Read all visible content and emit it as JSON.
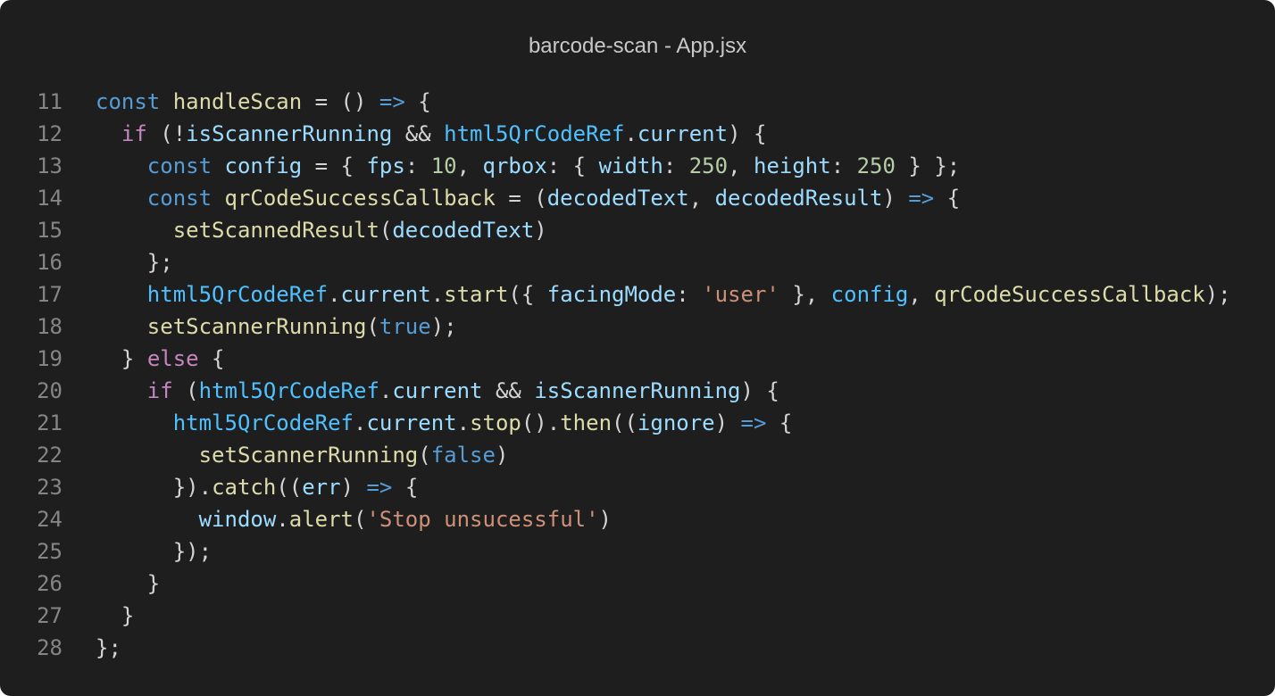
{
  "window": {
    "title": "barcode-scan - App.jsx"
  },
  "colors": {
    "background": "#1e1e1e",
    "line_number": "#858585",
    "keyword": "#569cd6",
    "control": "#c586c0",
    "function": "#dcdcaa",
    "variable": "#9cdcfe",
    "constant": "#4fc1ff",
    "number": "#b5cea8",
    "string": "#ce9178",
    "punctuation": "#d4d4d4"
  },
  "editor": {
    "lines": [
      {
        "number": "11",
        "indent": "",
        "tokens": [
          {
            "t": "const",
            "k": "kw"
          },
          {
            "t": " ",
            "k": "punc"
          },
          {
            "t": "handleScan",
            "k": "fn"
          },
          {
            "t": " = () ",
            "k": "punc"
          },
          {
            "t": "=>",
            "k": "kw"
          },
          {
            "t": " {",
            "k": "punc"
          }
        ]
      },
      {
        "number": "12",
        "indent": "  ",
        "tokens": [
          {
            "t": "if",
            "k": "ctl"
          },
          {
            "t": " (!",
            "k": "punc"
          },
          {
            "t": "isScannerRunning",
            "k": "var"
          },
          {
            "t": " && ",
            "k": "punc"
          },
          {
            "t": "html5QrCodeRef",
            "k": "const"
          },
          {
            "t": ".",
            "k": "punc"
          },
          {
            "t": "current",
            "k": "var"
          },
          {
            "t": ") {",
            "k": "punc"
          }
        ]
      },
      {
        "number": "13",
        "indent": "    ",
        "tokens": [
          {
            "t": "const",
            "k": "kw"
          },
          {
            "t": " ",
            "k": "punc"
          },
          {
            "t": "config",
            "k": "var"
          },
          {
            "t": " = { ",
            "k": "punc"
          },
          {
            "t": "fps",
            "k": "var"
          },
          {
            "t": ": ",
            "k": "punc"
          },
          {
            "t": "10",
            "k": "num"
          },
          {
            "t": ", ",
            "k": "punc"
          },
          {
            "t": "qrbox",
            "k": "var"
          },
          {
            "t": ": { ",
            "k": "punc"
          },
          {
            "t": "width",
            "k": "var"
          },
          {
            "t": ": ",
            "k": "punc"
          },
          {
            "t": "250",
            "k": "num"
          },
          {
            "t": ", ",
            "k": "punc"
          },
          {
            "t": "height",
            "k": "var"
          },
          {
            "t": ": ",
            "k": "punc"
          },
          {
            "t": "250",
            "k": "num"
          },
          {
            "t": " } };",
            "k": "punc"
          }
        ]
      },
      {
        "number": "14",
        "indent": "    ",
        "tokens": [
          {
            "t": "const",
            "k": "kw"
          },
          {
            "t": " ",
            "k": "punc"
          },
          {
            "t": "qrCodeSuccessCallback",
            "k": "fn"
          },
          {
            "t": " = (",
            "k": "punc"
          },
          {
            "t": "decodedText",
            "k": "var"
          },
          {
            "t": ", ",
            "k": "punc"
          },
          {
            "t": "decodedResult",
            "k": "var"
          },
          {
            "t": ") ",
            "k": "punc"
          },
          {
            "t": "=>",
            "k": "kw"
          },
          {
            "t": " {",
            "k": "punc"
          }
        ]
      },
      {
        "number": "15",
        "indent": "      ",
        "tokens": [
          {
            "t": "setScannedResult",
            "k": "fn"
          },
          {
            "t": "(",
            "k": "punc"
          },
          {
            "t": "decodedText",
            "k": "var"
          },
          {
            "t": ")",
            "k": "punc"
          }
        ]
      },
      {
        "number": "16",
        "indent": "    ",
        "tokens": [
          {
            "t": "};",
            "k": "punc"
          }
        ]
      },
      {
        "number": "17",
        "indent": "    ",
        "tokens": [
          {
            "t": "html5QrCodeRef",
            "k": "const"
          },
          {
            "t": ".",
            "k": "punc"
          },
          {
            "t": "current",
            "k": "var"
          },
          {
            "t": ".",
            "k": "punc"
          },
          {
            "t": "start",
            "k": "fn"
          },
          {
            "t": "({ ",
            "k": "punc"
          },
          {
            "t": "facingMode",
            "k": "var"
          },
          {
            "t": ": ",
            "k": "punc"
          },
          {
            "t": "'user'",
            "k": "str"
          },
          {
            "t": " }, ",
            "k": "punc"
          },
          {
            "t": "config",
            "k": "const"
          },
          {
            "t": ", ",
            "k": "punc"
          },
          {
            "t": "qrCodeSuccessCallback",
            "k": "fn"
          },
          {
            "t": ");",
            "k": "punc"
          }
        ]
      },
      {
        "number": "18",
        "indent": "    ",
        "tokens": [
          {
            "t": "setScannerRunning",
            "k": "fn"
          },
          {
            "t": "(",
            "k": "punc"
          },
          {
            "t": "true",
            "k": "kw"
          },
          {
            "t": ");",
            "k": "punc"
          }
        ]
      },
      {
        "number": "19",
        "indent": "  ",
        "tokens": [
          {
            "t": "} ",
            "k": "punc"
          },
          {
            "t": "else",
            "k": "ctl"
          },
          {
            "t": " {",
            "k": "punc"
          }
        ]
      },
      {
        "number": "20",
        "indent": "    ",
        "tokens": [
          {
            "t": "if",
            "k": "ctl"
          },
          {
            "t": " (",
            "k": "punc"
          },
          {
            "t": "html5QrCodeRef",
            "k": "const"
          },
          {
            "t": ".",
            "k": "punc"
          },
          {
            "t": "current",
            "k": "var"
          },
          {
            "t": " && ",
            "k": "punc"
          },
          {
            "t": "isScannerRunning",
            "k": "var"
          },
          {
            "t": ") {",
            "k": "punc"
          }
        ]
      },
      {
        "number": "21",
        "indent": "      ",
        "tokens": [
          {
            "t": "html5QrCodeRef",
            "k": "const"
          },
          {
            "t": ".",
            "k": "punc"
          },
          {
            "t": "current",
            "k": "var"
          },
          {
            "t": ".",
            "k": "punc"
          },
          {
            "t": "stop",
            "k": "fn"
          },
          {
            "t": "().",
            "k": "punc"
          },
          {
            "t": "then",
            "k": "fn"
          },
          {
            "t": "((",
            "k": "punc"
          },
          {
            "t": "ignore",
            "k": "var"
          },
          {
            "t": ") ",
            "k": "punc"
          },
          {
            "t": "=>",
            "k": "kw"
          },
          {
            "t": " {",
            "k": "punc"
          }
        ]
      },
      {
        "number": "22",
        "indent": "        ",
        "tokens": [
          {
            "t": "setScannerRunning",
            "k": "fn"
          },
          {
            "t": "(",
            "k": "punc"
          },
          {
            "t": "false",
            "k": "kw"
          },
          {
            "t": ")",
            "k": "punc"
          }
        ]
      },
      {
        "number": "23",
        "indent": "      ",
        "tokens": [
          {
            "t": "}).",
            "k": "punc"
          },
          {
            "t": "catch",
            "k": "fn"
          },
          {
            "t": "((",
            "k": "punc"
          },
          {
            "t": "err",
            "k": "var"
          },
          {
            "t": ") ",
            "k": "punc"
          },
          {
            "t": "=>",
            "k": "kw"
          },
          {
            "t": " {",
            "k": "punc"
          }
        ]
      },
      {
        "number": "24",
        "indent": "        ",
        "tokens": [
          {
            "t": "window",
            "k": "var"
          },
          {
            "t": ".",
            "k": "punc"
          },
          {
            "t": "alert",
            "k": "fn"
          },
          {
            "t": "(",
            "k": "punc"
          },
          {
            "t": "'Stop unsucessful'",
            "k": "str"
          },
          {
            "t": ")",
            "k": "punc"
          }
        ]
      },
      {
        "number": "25",
        "indent": "      ",
        "tokens": [
          {
            "t": "});",
            "k": "punc"
          }
        ]
      },
      {
        "number": "26",
        "indent": "    ",
        "tokens": [
          {
            "t": "}",
            "k": "punc"
          }
        ]
      },
      {
        "number": "27",
        "indent": "  ",
        "tokens": [
          {
            "t": "}",
            "k": "punc"
          }
        ]
      },
      {
        "number": "28",
        "indent": "",
        "tokens": [
          {
            "t": "};",
            "k": "punc"
          }
        ]
      }
    ]
  }
}
